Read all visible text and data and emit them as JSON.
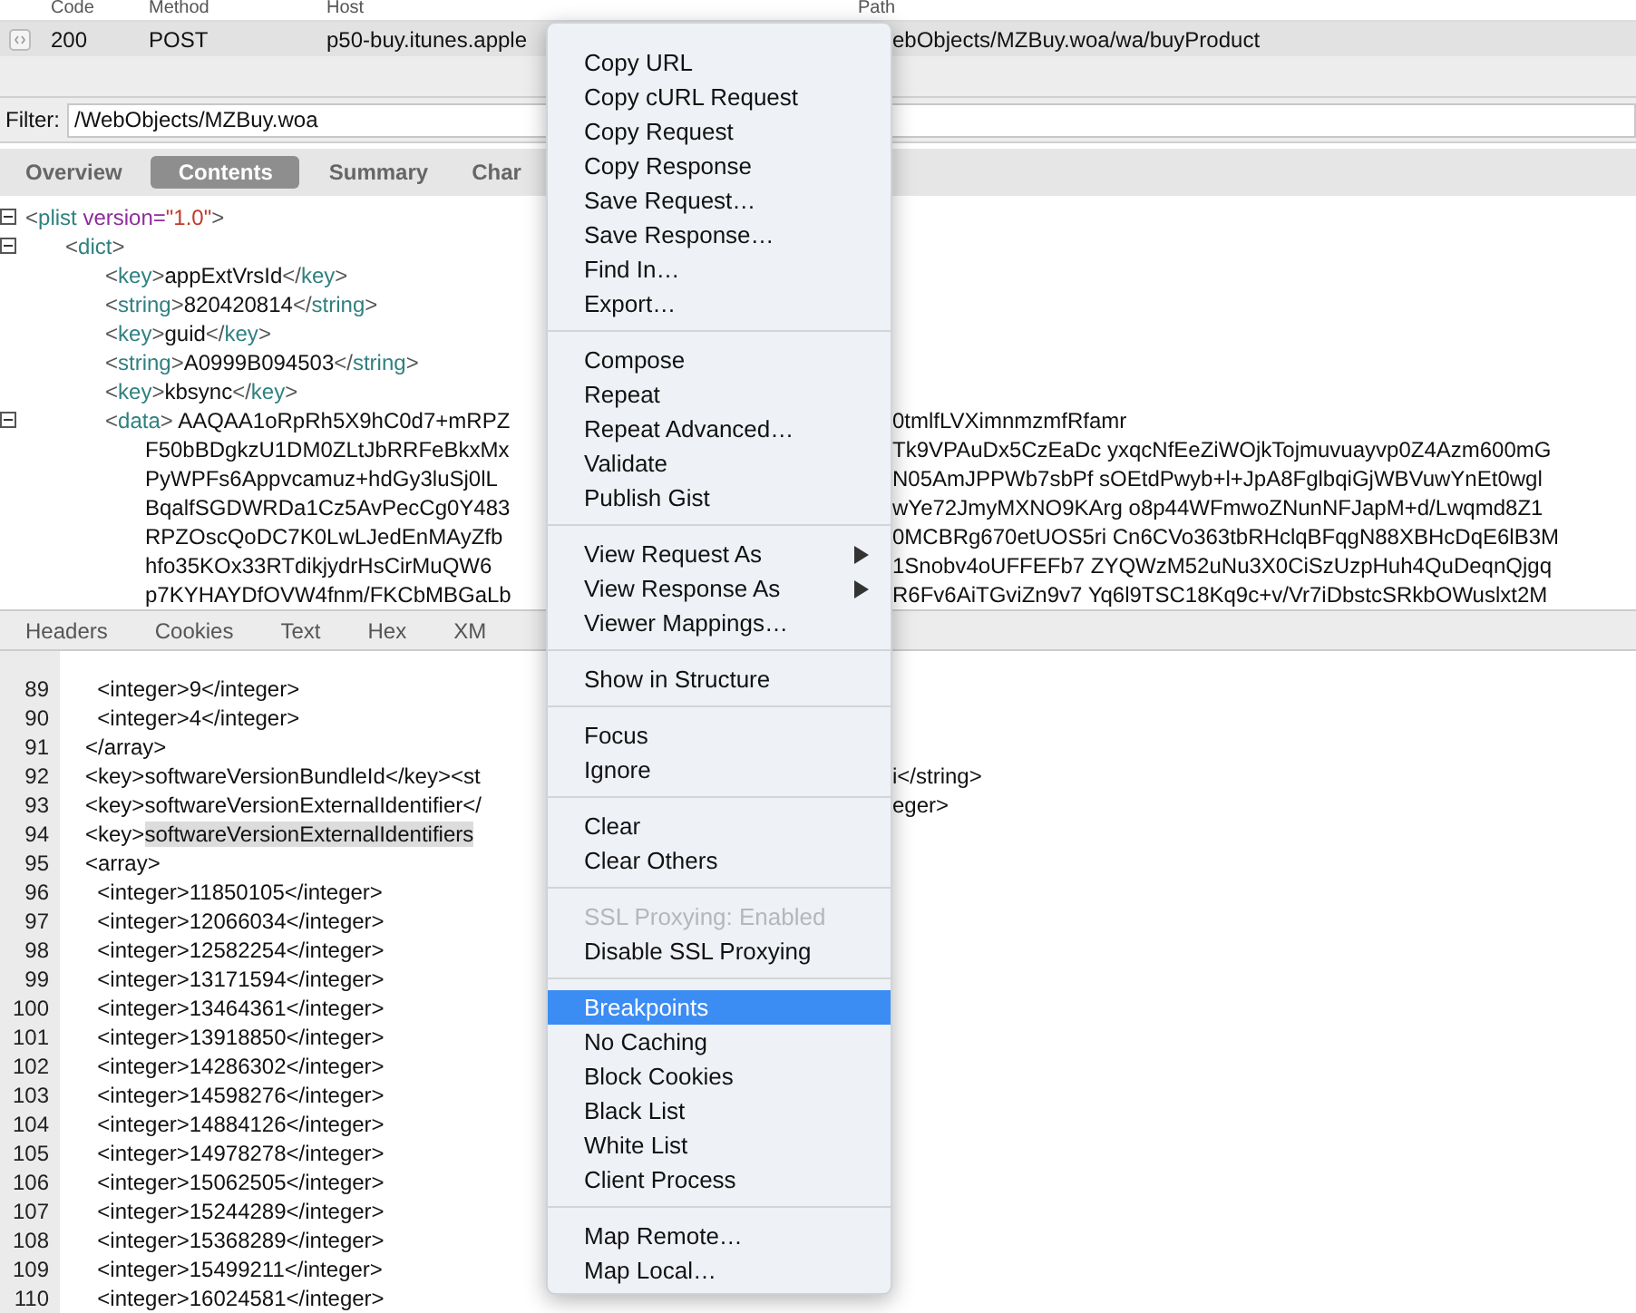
{
  "request_table": {
    "columns": [
      {
        "label": "Code"
      },
      {
        "label": "Method"
      },
      {
        "label": "Host"
      },
      {
        "label": "Path"
      }
    ],
    "rows": [
      {
        "selected": true,
        "code": "200",
        "method": "POST",
        "host": "p50-buy.itunes.apple",
        "path": "ebObjects/MZBuy.woa/wa/buyProduct"
      }
    ]
  },
  "filter": {
    "label": "Filter:",
    "value": "/WebObjects/MZBuy.woa"
  },
  "view_tabs": [
    {
      "label": "Overview",
      "selected": false
    },
    {
      "label": "Contents",
      "selected": true
    },
    {
      "label": "Summary",
      "selected": false
    },
    {
      "label": "Char",
      "selected": false
    }
  ],
  "xml_tree": [
    {
      "text": "<plist version=\"1.0\">",
      "expanded": true,
      "children": [
        {
          "text": "<dict>",
          "expanded": true,
          "children": [
            {
              "text": "<key>appExtVrsId</key>"
            },
            {
              "text": "<string>820420814</string>"
            },
            {
              "text": "<key>guid</key>"
            },
            {
              "text": "<string>A0999B094503</string>"
            },
            {
              "text": "<key>kbsync</key>"
            },
            {
              "text": "<data> AAQAA1oRpRh5X9hC0d7+mRPZ",
              "right": "0tmlfLVXimnmzmfRfamr",
              "expanded": true,
              "children": [
                {
                  "text": "F50bBDgkzU1DM0ZLtJbRRFeBkxMx",
                  "right": "Tk9VPAuDx5CzEaDc yxqcNfEeZiWOjkTojmuvuayvp0Z4Azm600mG"
                },
                {
                  "text": "PyWPFs6Appvcamuz+hdGy3luSj0lL",
                  "right": "N05AmJPPWb7sbPf sOEtdPwyb+l+JpA8FglbqiGjWBVuwYnEt0wgl"
                },
                {
                  "text": "BqalfSGDWRDa1Cz5AvPecCg0Y483",
                  "right": "wYe72JmyMXNO9KArg o8p44WFmwoZNunNFJapM+d/Lwqmd8Z1"
                },
                {
                  "text": "RPZOscQoDC7K0LwLJedEnMAyZfb",
                  "right": "0MCBRg670etUOS5ri Cn6CVo363tbRHclqBFqgN88XBHcDqE6lB3M"
                },
                {
                  "text": "hfo35KOx33RTdikjydrHsCirMuQW6",
                  "right": "1Snobv4oUFFEFb7 ZYQWzM52uNu3X0CiSzUzpHuh4QuDeqnQjgq"
                },
                {
                  "text": "p7KYHAYDfOVW4fnm/FKCbMBGaLb",
                  "right": "R6Fv6AiTGviZn9v7 Yq6l9TSC18Kq9c+v/Vr7iDbstcSRkbOWuslxt2M"
                }
              ]
            }
          ]
        }
      ]
    }
  ],
  "detail_tabs": [
    {
      "label": "Headers",
      "selected": false
    },
    {
      "label": "Cookies",
      "selected": false
    },
    {
      "label": "Text",
      "selected": false
    },
    {
      "label": "Hex",
      "selected": false
    },
    {
      "label": "XM",
      "selected": false
    }
  ],
  "source_lines": [
    {
      "number": "89",
      "text": "  <integer>9</integer>"
    },
    {
      "number": "90",
      "text": "  <integer>4</integer>"
    },
    {
      "number": "91",
      "text": "</array>"
    },
    {
      "number": "92",
      "text": "<key>softwareVersionBundleId</key><st",
      "right": "i</string>"
    },
    {
      "number": "93",
      "text": "<key>softwareVersionExternalIdentifier</",
      "right": "eger>"
    },
    {
      "number": "94",
      "text": "<key>",
      "highlight": "softwareVersionExternalIdentifiers"
    },
    {
      "number": "95",
      "text": "<array>"
    },
    {
      "number": "96",
      "text": "  <integer>11850105</integer>"
    },
    {
      "number": "97",
      "text": "  <integer>12066034</integer>"
    },
    {
      "number": "98",
      "text": "  <integer>12582254</integer>"
    },
    {
      "number": "99",
      "text": "  <integer>13171594</integer>"
    },
    {
      "number": "100",
      "text": "  <integer>13464361</integer>"
    },
    {
      "number": "101",
      "text": "  <integer>13918850</integer>"
    },
    {
      "number": "102",
      "text": "  <integer>14286302</integer>"
    },
    {
      "number": "103",
      "text": "  <integer>14598276</integer>"
    },
    {
      "number": "104",
      "text": "  <integer>14884126</integer>"
    },
    {
      "number": "105",
      "text": "  <integer>14978278</integer>"
    },
    {
      "number": "106",
      "text": "  <integer>15062505</integer>"
    },
    {
      "number": "107",
      "text": "  <integer>15244289</integer>"
    },
    {
      "number": "108",
      "text": "  <integer>15368289</integer>"
    },
    {
      "number": "109",
      "text": "  <integer>15499211</integer>"
    },
    {
      "number": "110",
      "text": "  <integer>16024581</integer>"
    }
  ],
  "context_menu": [
    [
      {
        "label": "Copy URL",
        "selected": false,
        "disabled": false,
        "submenu": false
      },
      {
        "label": "Copy cURL Request",
        "selected": false,
        "disabled": false,
        "submenu": false
      },
      {
        "label": "Copy Request",
        "selected": false,
        "disabled": false,
        "submenu": false
      },
      {
        "label": "Copy Response",
        "selected": false,
        "disabled": false,
        "submenu": false
      },
      {
        "label": "Save Request…",
        "selected": false,
        "disabled": false,
        "submenu": false
      },
      {
        "label": "Save Response…",
        "selected": false,
        "disabled": false,
        "submenu": false
      },
      {
        "label": "Find In…",
        "selected": false,
        "disabled": false,
        "submenu": false
      },
      {
        "label": "Export…",
        "selected": false,
        "disabled": false,
        "submenu": false
      }
    ],
    [
      {
        "label": "Compose",
        "selected": false,
        "disabled": false,
        "submenu": false
      },
      {
        "label": "Repeat",
        "selected": false,
        "disabled": false,
        "submenu": false
      },
      {
        "label": "Repeat Advanced…",
        "selected": false,
        "disabled": false,
        "submenu": false
      },
      {
        "label": "Validate",
        "selected": false,
        "disabled": false,
        "submenu": false
      },
      {
        "label": "Publish Gist",
        "selected": false,
        "disabled": false,
        "submenu": false
      }
    ],
    [
      {
        "label": "View Request As",
        "selected": false,
        "disabled": false,
        "submenu": true
      },
      {
        "label": "View Response As",
        "selected": false,
        "disabled": false,
        "submenu": true
      },
      {
        "label": "Viewer Mappings…",
        "selected": false,
        "disabled": false,
        "submenu": false
      }
    ],
    [
      {
        "label": "Show in Structure",
        "selected": false,
        "disabled": false,
        "submenu": false
      }
    ],
    [
      {
        "label": "Focus",
        "selected": false,
        "disabled": false,
        "submenu": false
      },
      {
        "label": "Ignore",
        "selected": false,
        "disabled": false,
        "submenu": false
      }
    ],
    [
      {
        "label": "Clear",
        "selected": false,
        "disabled": false,
        "submenu": false
      },
      {
        "label": "Clear Others",
        "selected": false,
        "disabled": false,
        "submenu": false
      }
    ],
    [
      {
        "label": "SSL Proxying: Enabled",
        "selected": false,
        "disabled": true,
        "submenu": false
      },
      {
        "label": "Disable SSL Proxying",
        "selected": false,
        "disabled": false,
        "submenu": false
      }
    ],
    [
      {
        "label": "Breakpoints",
        "selected": true,
        "disabled": false,
        "submenu": false
      },
      {
        "label": "No Caching",
        "selected": false,
        "disabled": false,
        "submenu": false
      },
      {
        "label": "Block Cookies",
        "selected": false,
        "disabled": false,
        "submenu": false
      },
      {
        "label": "Black List",
        "selected": false,
        "disabled": false,
        "submenu": false
      },
      {
        "label": "White List",
        "selected": false,
        "disabled": false,
        "submenu": false
      },
      {
        "label": "Client Process",
        "selected": false,
        "disabled": false,
        "submenu": false
      }
    ],
    [
      {
        "label": "Map Remote…",
        "selected": false,
        "disabled": false,
        "submenu": false
      },
      {
        "label": "Map Local…",
        "selected": false,
        "disabled": false,
        "submenu": false
      }
    ]
  ]
}
